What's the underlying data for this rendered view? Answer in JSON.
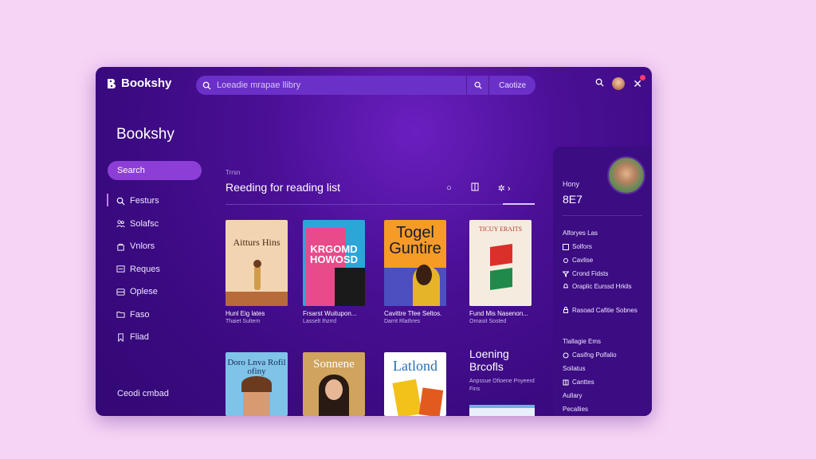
{
  "app": {
    "name": "Bookshy"
  },
  "search": {
    "placeholder": "Loeadie mrapae llibry",
    "action_label": "Caotize"
  },
  "sidebar": {
    "title": "Bookshy",
    "primary_button": "Search",
    "items": [
      {
        "label": "Festurs",
        "icon": "search-icon"
      },
      {
        "label": "Solafsc",
        "icon": "people-icon"
      },
      {
        "label": "Vnlors",
        "icon": "bag-icon"
      },
      {
        "label": "Reques",
        "icon": "chart-icon"
      },
      {
        "label": "Oplese",
        "icon": "grid-icon"
      },
      {
        "label": "Faso",
        "icon": "folder-icon"
      },
      {
        "label": "Fliad",
        "icon": "bookmark-icon"
      }
    ],
    "footer": "Ceodi cmbad"
  },
  "main": {
    "breadcrumb": "Trrsn",
    "title": "Reeding for reading list",
    "books_row1": [
      {
        "title": "Hunl Eig lates",
        "author": "Thaiet Sultern",
        "cover_text": "Aitturs Hins",
        "cover_color": "#f3d4b0"
      },
      {
        "title": "Frsarst Wuitupon...",
        "author": "Lasselt Ihzrrd",
        "cover_text": "KRGOMD HOWOSD",
        "cover_color": "#2ca6d6"
      },
      {
        "title": "Cavittre Tfee Seltos.",
        "author": "Darrit Rlathres",
        "cover_text": "Togel Guntire",
        "cover_color": "#f59b26"
      },
      {
        "title": "Fund Mis Nasenon...",
        "author": "Ornasit Sosted",
        "cover_text": "TICUY ERAITS",
        "cover_color": "#f5ecdf"
      }
    ],
    "books_row2": [
      {
        "cover_text": "Doro Lnva Rofil ofiny",
        "cover_color": "#7fc3e8"
      },
      {
        "cover_text": "Sonnene",
        "cover_color": "#d0a35e"
      },
      {
        "cover_text": "Latlond",
        "cover_color": "#ffffff"
      }
    ],
    "promo": {
      "heading": "Loening Brcofls",
      "sub": "Anpssue Ofioene Pnyeerd Fins"
    }
  },
  "right_panel": {
    "name": "Hony",
    "count": "8E7",
    "items": [
      {
        "label": "Alforyes Las",
        "icon": ""
      },
      {
        "label": "Solfors",
        "icon": "list-icon"
      },
      {
        "label": "Cavlise",
        "icon": "gear-icon"
      },
      {
        "label": "Crond Fidsts",
        "icon": "filter-icon"
      },
      {
        "label": "Oraplic Eurssd Hrkils",
        "icon": "bell-icon",
        "two": true
      },
      {
        "label": "Rasoad Cafitie Sobnes",
        "icon": "lock-icon",
        "two": true
      },
      {
        "label": "Tlallagie Ems",
        "icon": ""
      },
      {
        "label": "Casifng Polfalio",
        "icon": "tag-icon"
      },
      {
        "label": "Soilatus",
        "icon": ""
      },
      {
        "label": "Canttes",
        "icon": "book-icon"
      },
      {
        "label": "Aullary",
        "icon": ""
      },
      {
        "label": "Pecallies",
        "icon": ""
      }
    ]
  },
  "colors": {
    "background": "#f6d4f6",
    "window": "#3a0a80",
    "accent": "#8d3ed6"
  }
}
